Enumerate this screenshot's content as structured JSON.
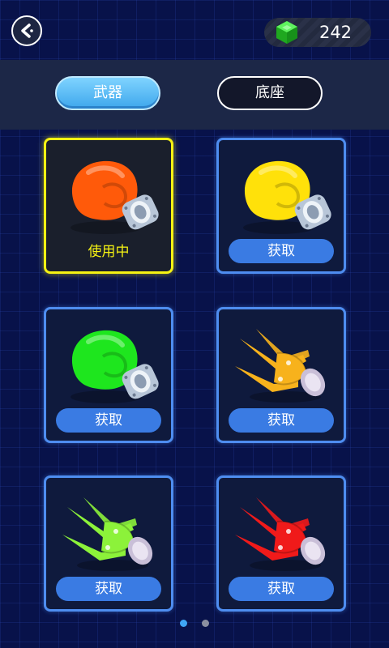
{
  "header": {
    "gem_count": "242"
  },
  "tabs": [
    {
      "label": "武器",
      "active": true
    },
    {
      "label": "底座",
      "active": false
    }
  ],
  "items": [
    {
      "kind": "glove",
      "color": "#ff5a0a",
      "status": "使用中",
      "selected": true
    },
    {
      "kind": "glove",
      "color": "#ffe10a",
      "status": "获取",
      "selected": false
    },
    {
      "kind": "glove",
      "color": "#1ee61e",
      "status": "获取",
      "selected": false
    },
    {
      "kind": "claw",
      "color": "#f7b21c",
      "status": "获取",
      "selected": false
    },
    {
      "kind": "claw",
      "color": "#8cf23a",
      "status": "获取",
      "selected": false
    },
    {
      "kind": "claw",
      "color": "#f01a1a",
      "status": "获取",
      "selected": false
    }
  ],
  "pagination": {
    "current": 1,
    "total": 2
  },
  "colors": {
    "accent_blue": "#3a7be3",
    "selected_yellow": "#f5f213",
    "gem_green": "#2ed12e"
  }
}
